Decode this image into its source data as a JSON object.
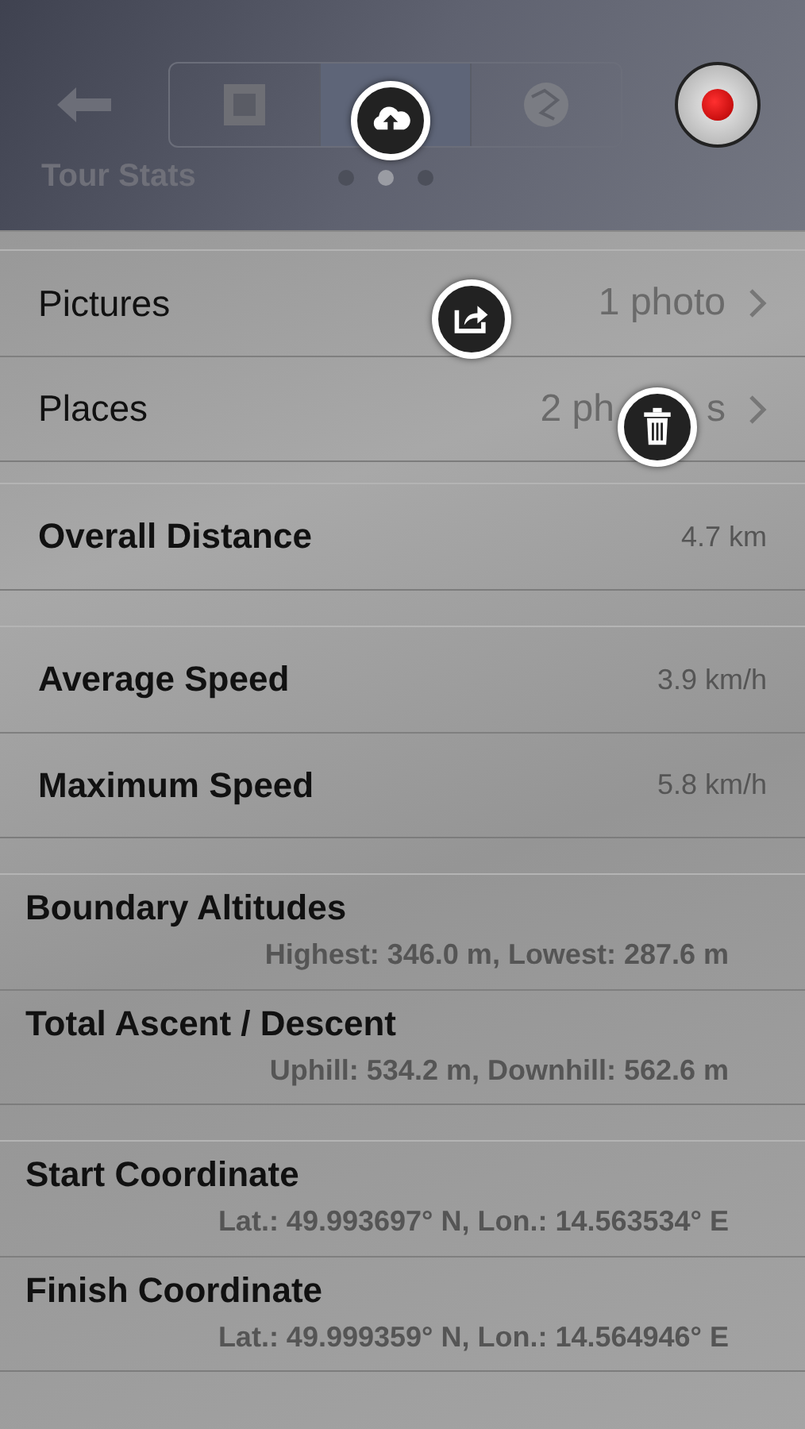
{
  "header": {
    "title": "Tour Stats",
    "segments": [
      {
        "selected": false
      },
      {
        "selected": true
      },
      {
        "selected": false
      }
    ],
    "page_dots": [
      {
        "selected": false
      },
      {
        "selected": true
      },
      {
        "selected": false
      }
    ]
  },
  "groups": [
    {
      "rows": [
        {
          "kind": "link",
          "label": "Pictures",
          "value": "1 photo"
        },
        {
          "kind": "link",
          "label": "Places",
          "value": "2 ph",
          "value_tail": "s"
        }
      ]
    },
    {
      "rows": [
        {
          "kind": "value",
          "label": "Overall Distance",
          "value": "4.7 km"
        }
      ]
    },
    {
      "rows": [
        {
          "kind": "value",
          "label": "Average Speed",
          "value": "3.9 km/h"
        },
        {
          "kind": "value",
          "label": "Maximum Speed",
          "value": "5.8 km/h"
        }
      ]
    },
    {
      "rows": [
        {
          "kind": "detail",
          "label": "Boundary Altitudes",
          "value": "Highest: 346.0 m, Lowest: 287.6 m"
        },
        {
          "kind": "detail",
          "label": "Total Ascent / Descent",
          "value": "Uphill: 534.2 m, Downhill: 562.6 m"
        }
      ]
    },
    {
      "rows": [
        {
          "kind": "detail",
          "label": "Start Coordinate",
          "value": "Lat.: 49.993697° N, Lon.: 14.563534° E"
        },
        {
          "kind": "detail",
          "label": "Finish Coordinate",
          "value": "Lat.: 49.999359° N, Lon.: 14.564946° E"
        }
      ]
    }
  ],
  "floating_buttons": [
    {
      "kind": "upload"
    },
    {
      "kind": "share"
    },
    {
      "kind": "delete"
    }
  ]
}
